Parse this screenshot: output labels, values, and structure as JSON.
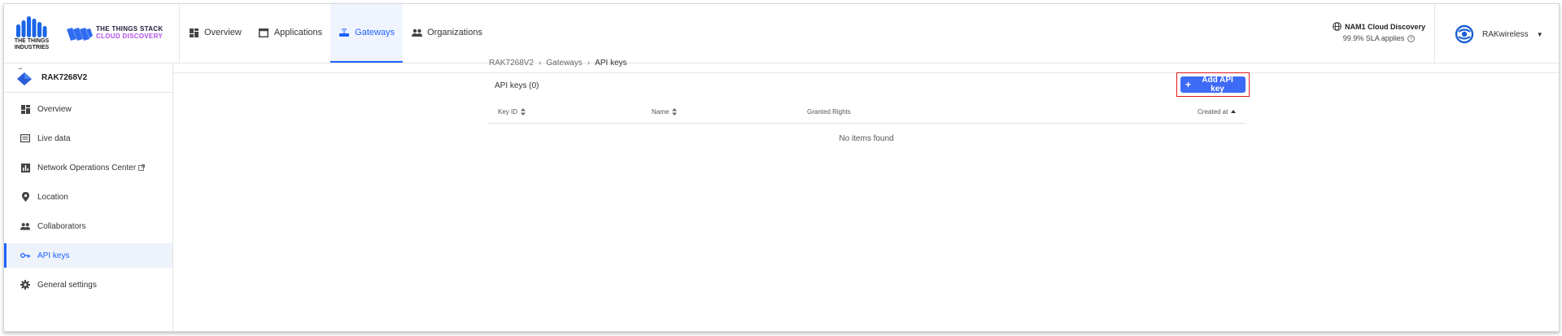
{
  "brand": {
    "org_logo_text": "THE THINGS INDUSTRIES",
    "product_line1": "THE THINGS STACK",
    "product_line2": "CLOUD DISCOVERY"
  },
  "nav": [
    {
      "label": "Overview",
      "icon": "grid-icon"
    },
    {
      "label": "Applications",
      "icon": "window-icon"
    },
    {
      "label": "Gateways",
      "icon": "router-icon",
      "active": true
    },
    {
      "label": "Organizations",
      "icon": "people-icon"
    }
  ],
  "cluster": {
    "name": "NAM1 Cloud Discovery",
    "sla": "99.9% SLA applies"
  },
  "user": {
    "name": "RAKwireless"
  },
  "sidebar": {
    "gateway_name": "RAK7268V2",
    "items": [
      {
        "label": "Overview",
        "icon": "grid-icon"
      },
      {
        "label": "Live data",
        "icon": "list-icon"
      },
      {
        "label": "Network Operations Center",
        "icon": "chart-icon"
      },
      {
        "label": "Location",
        "icon": "pin-icon"
      },
      {
        "label": "Collaborators",
        "icon": "people-icon"
      },
      {
        "label": "API keys",
        "icon": "key-icon",
        "active": true
      },
      {
        "label": "General settings",
        "icon": "gear-icon"
      }
    ]
  },
  "breadcrumb": [
    "RAK7268V2",
    "Gateways",
    "API keys"
  ],
  "main": {
    "title": "API keys (0)",
    "add_button": "Add API key",
    "columns": [
      "Key ID",
      "Name",
      "Granted Rights",
      "Created at"
    ],
    "empty_text": "No items found"
  },
  "colors": {
    "accent": "#1f62ff",
    "button": "#3e6bf5",
    "highlight_box": "#e0191a"
  }
}
